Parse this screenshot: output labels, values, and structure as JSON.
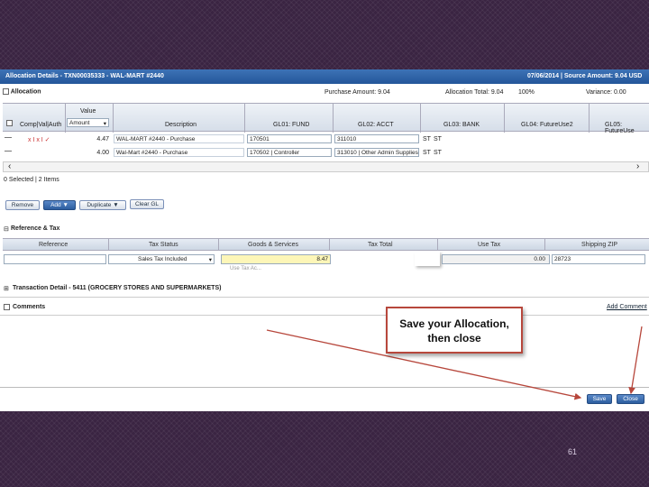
{
  "window": {
    "title": "Allocation Details - TXN00035333 - WAL-MART #2440",
    "date_source": "07/06/2014 | Source Amount: 9.04 USD"
  },
  "allocation": {
    "section_label": "Allocation",
    "purchase_amount": "Purchase Amount: 9.04",
    "allocation_total": "Allocation Total: 9.04",
    "percent": "100%",
    "variance": "Variance: 0.00",
    "value_label": "Value",
    "value_select": "Amount",
    "columns": [
      "Comp|Val|Auth",
      "Description",
      "GL01: FUND",
      "GL02: ACCT",
      "GL03: BANK",
      "GL04: FutureUse2",
      "GL05: FutureUse"
    ],
    "rows": [
      {
        "flags": "x I x I ✓",
        "amount": "4.47",
        "description": "WAL-MART #2440 - Purchase",
        "gl01": "170501",
        "gl02": "311010",
        "gl03": "ST",
        "gl03b": "ST"
      },
      {
        "flags": "",
        "amount": "4.00",
        "description": "Wal-Mart #2440 - Purchase",
        "gl01": "170502 | Controller",
        "gl02": "313010 | Other Admin Supplies",
        "gl03": "ST",
        "gl03b": "ST"
      }
    ],
    "selected_text": "0 Selected | 2 Items",
    "buttons": {
      "remove": "Remove",
      "add": "Add ▼",
      "duplicate": "Duplicate ▼",
      "clear_gl": "Clear GL"
    }
  },
  "reference_tax": {
    "section_label": "Reference & Tax",
    "columns": [
      "Reference",
      "Tax Status",
      "Goods & Services",
      "Tax Total",
      "Use Tax",
      "Shipping ZIP"
    ],
    "tax_status_value": "Sales Tax Included",
    "goods_value": "8.47",
    "use_tax_value": "0.00",
    "zip_value": "28723",
    "partial_label": "Use Tax Ac..."
  },
  "transaction_detail": {
    "label": "Transaction Detail - 5411 (GROCERY STORES AND SUPERMARKETS)"
  },
  "comments": {
    "label": "Comments",
    "add_comment": "Add Comment"
  },
  "footer": {
    "save": "Save",
    "close": "Close"
  },
  "callout": {
    "line1": "Save your Allocation,",
    "line2": "then close"
  },
  "slide": {
    "page_number": "61"
  },
  "colors": {
    "titlebar": "#2f63a8",
    "arrow": "#b7473c",
    "background": "#3a2442"
  }
}
